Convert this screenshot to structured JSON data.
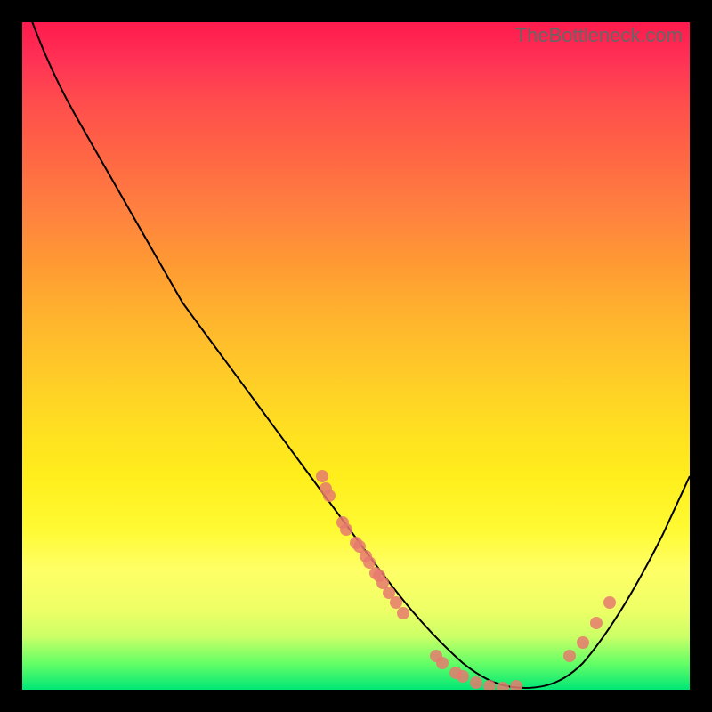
{
  "watermark": "TheBottleneck.com",
  "chart_data": {
    "type": "line",
    "title": "",
    "xlabel": "",
    "ylabel": "",
    "xlim": [
      0,
      100
    ],
    "ylim": [
      0,
      100
    ],
    "curve": [
      {
        "x": 0,
        "y": 104
      },
      {
        "x": 4,
        "y": 98
      },
      {
        "x": 8,
        "y": 93
      },
      {
        "x": 12,
        "y": 86
      },
      {
        "x": 16,
        "y": 79
      },
      {
        "x": 36,
        "y": 45
      },
      {
        "x": 52,
        "y": 20
      },
      {
        "x": 60,
        "y": 8
      },
      {
        "x": 66,
        "y": 2
      },
      {
        "x": 72,
        "y": 0
      },
      {
        "x": 78,
        "y": 1
      },
      {
        "x": 84,
        "y": 6
      },
      {
        "x": 90,
        "y": 15
      },
      {
        "x": 96,
        "y": 26
      },
      {
        "x": 100,
        "y": 34
      }
    ],
    "scatter_points": [
      {
        "x": 45,
        "y": 32
      },
      {
        "x": 45.5,
        "y": 30
      },
      {
        "x": 46,
        "y": 29
      },
      {
        "x": 48,
        "y": 25
      },
      {
        "x": 48.5,
        "y": 24
      },
      {
        "x": 50,
        "y": 22
      },
      {
        "x": 50.5,
        "y": 21.5
      },
      {
        "x": 51.5,
        "y": 20
      },
      {
        "x": 52,
        "y": 19
      },
      {
        "x": 53,
        "y": 17.5
      },
      {
        "x": 53.5,
        "y": 17
      },
      {
        "x": 54,
        "y": 16
      },
      {
        "x": 55,
        "y": 14.5
      },
      {
        "x": 56,
        "y": 13
      },
      {
        "x": 57,
        "y": 11.5
      },
      {
        "x": 62,
        "y": 5
      },
      {
        "x": 63,
        "y": 4
      },
      {
        "x": 65,
        "y": 2.5
      },
      {
        "x": 66,
        "y": 2
      },
      {
        "x": 68,
        "y": 1
      },
      {
        "x": 70,
        "y": 0.5
      },
      {
        "x": 72,
        "y": 0
      },
      {
        "x": 74,
        "y": 0.5
      },
      {
        "x": 82,
        "y": 5
      },
      {
        "x": 84,
        "y": 7
      },
      {
        "x": 86,
        "y": 10
      },
      {
        "x": 88,
        "y": 13
      }
    ],
    "background_gradient": {
      "top": "#ff1a4d",
      "middle": "#ffdd22",
      "bottom": "#00e676"
    }
  }
}
